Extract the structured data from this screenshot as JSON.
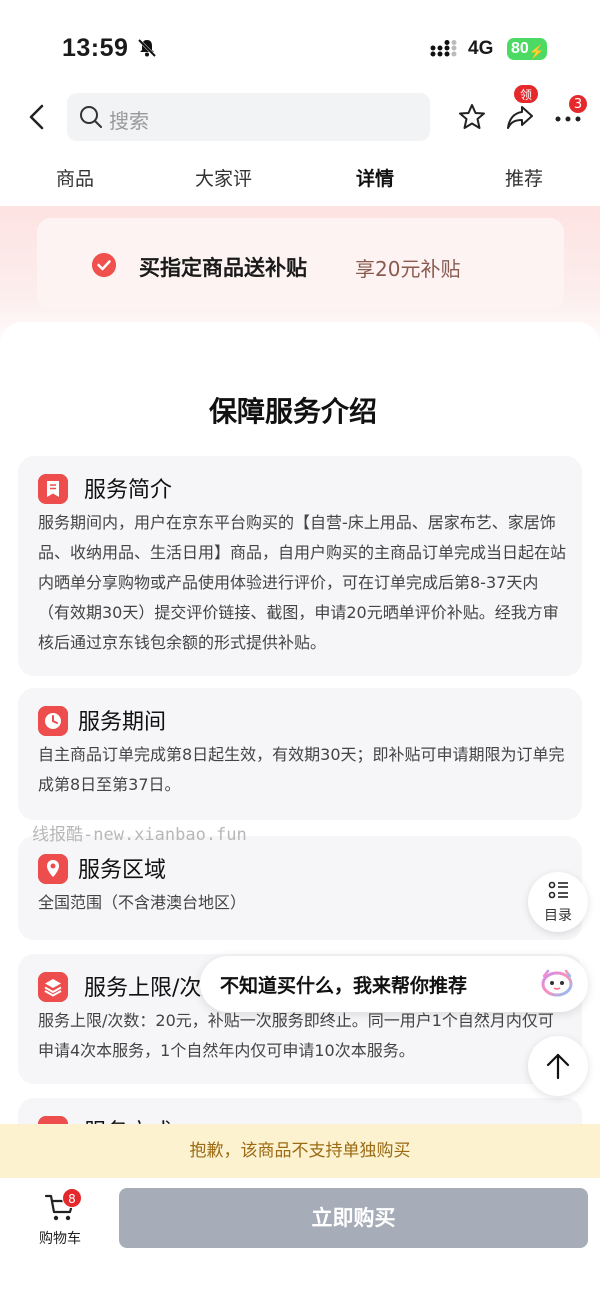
{
  "status_bar": {
    "time": "13:59",
    "network": "4G",
    "battery": "80"
  },
  "search": {
    "placeholder": "搜索"
  },
  "nav": {
    "share_badge": "领",
    "more_badge": "3"
  },
  "tabs": [
    {
      "label": "商品",
      "active": false
    },
    {
      "label": "大家评",
      "active": false
    },
    {
      "label": "详情",
      "active": true
    },
    {
      "label": "推荐",
      "active": false
    }
  ],
  "promo": {
    "title": "买指定商品送补贴",
    "value": "享20元补贴"
  },
  "page_title": "保障服务介绍",
  "sections": [
    {
      "title": "服务简介",
      "body": "服务期间内，用户在京东平台购买的【自营-床上用品、居家布艺、家居饰品、收纳用品、生活日用】商品，自用户购买的主商品订单完成当日起在站内晒单分享购物或产品使用体验进行评价，可在订单完成后第8-37天内（有效期30天）提交评价链接、截图，申请20元晒单评价补贴。经我方审核后通过京东钱包余额的形式提供补贴。"
    },
    {
      "title": "服务期间",
      "body": "自主商品订单完成第8日起生效，有效期30天；即补贴可申请期限为订单完成第8日至第37日。"
    },
    {
      "title": "服务区域",
      "body": "全国范围（不含港澳台地区）"
    },
    {
      "title": "服务上限/次数",
      "body": "服务上限/次数：20元，补贴一次服务即终止。同一用户1个自然月内仅可申请4次本服务，1个自然年内仅可申请10次本服务。"
    },
    {
      "title": "服务方式",
      "body": ""
    }
  ],
  "watermark": "线报酷-new.xianbao.fun",
  "toc_label": "目录",
  "assistant_text": "不知道买什么，我来帮你推荐",
  "notice": "抱歉，该商品不支持单独购买",
  "cart": {
    "label": "购物车",
    "badge": "8"
  },
  "buy_button": "立即购买",
  "colors": {
    "accent": "#e4282b",
    "icon_red": "#ee4d4d",
    "notice_bg": "#fdf2cf",
    "buy_disabled": "#a7adb8"
  }
}
